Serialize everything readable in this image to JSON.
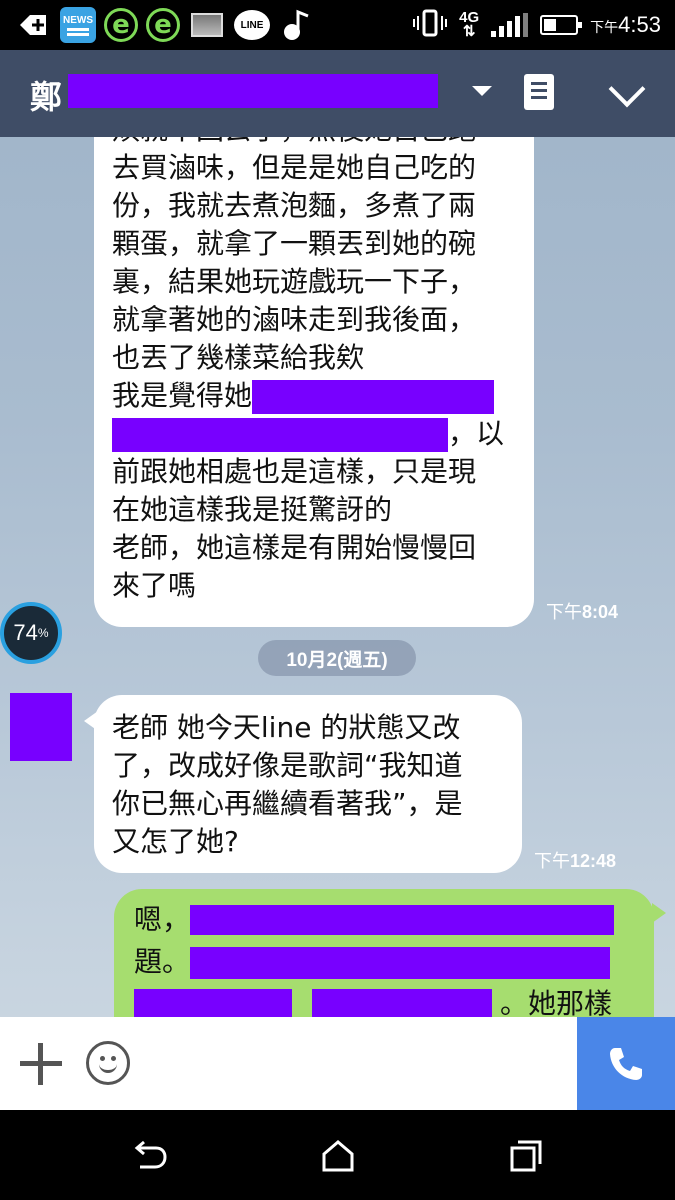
{
  "status_bar": {
    "news_label": "NEWS",
    "line_label": "LINE",
    "network": "4G",
    "clock_prefix": "下午",
    "clock_time": "4:53",
    "icons": [
      "add-icon",
      "news-icon",
      "browser-icon",
      "browser-icon",
      "image-icon",
      "line-icon",
      "music-icon",
      "vibrate-icon",
      "signal-icon",
      "battery-icon"
    ]
  },
  "header": {
    "title_prefix": "鄭"
  },
  "messages": {
    "m1": {
      "lines": [
        "煩就不回去了，然後她自己跑",
        "去買滷味，但是是她自己吃的",
        "份，我就去煮泡麵，多煮了兩",
        "顆蛋，就拿了一顆丟到她的碗",
        "裏，結果她玩遊戲玩一下子，",
        "就拿著她的滷味走到我後面，",
        "也丟了幾樣菜給我欸",
        "我是覺得她",
        "，以",
        "前跟她相處也是這樣，只是現",
        "在她這樣我是挺驚訝的",
        "老師，她這樣是有開始慢慢回",
        "來了嗎"
      ],
      "time_prefix": "下午",
      "time": "8:04"
    },
    "date_separator": "10月2(週五)",
    "floating_badge": "74",
    "floating_badge_unit": "%",
    "m2": {
      "lines": [
        "老師 她今天line 的狀態又改",
        "了，改成好像是歌詞“我知道",
        "你已無心再繼續看著我”，是",
        "又怎了她?"
      ],
      "time_prefix": "下午",
      "time": "12:48"
    },
    "m3": {
      "line1": "嗯，",
      "line2": "題。",
      "line3_tail": "。她那樣"
    }
  },
  "colors": {
    "header_bg": "#3f4d66",
    "sent_bubble": "#a6dd6f",
    "call_button": "#4a86e8",
    "redaction": "#7800ff"
  }
}
